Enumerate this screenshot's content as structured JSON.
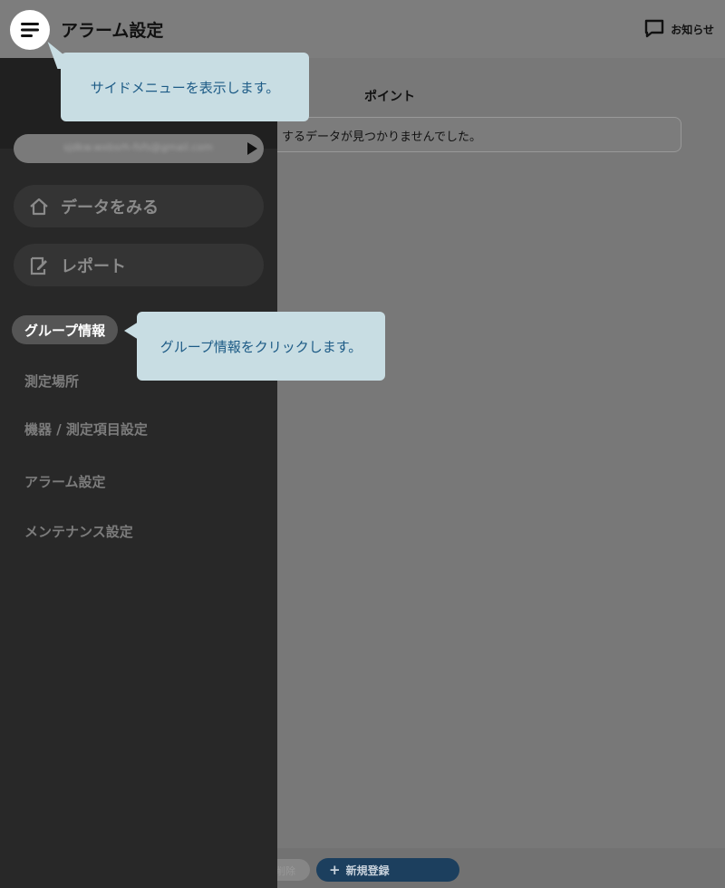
{
  "header": {
    "title": "アラーム設定",
    "notice_label": "お知らせ"
  },
  "main": {
    "column_title": "ポイント",
    "no_data_message": "するデータが見つかりませんでした。"
  },
  "bottom": {
    "delete_label": "削除",
    "new_label": "新規登録"
  },
  "sidebar": {
    "account_email": "sjdkw.wxbsrh-fsfs@gmail.com",
    "nav": [
      {
        "label": "データをみる",
        "icon": "home-icon"
      },
      {
        "label": "レポート",
        "icon": "report-icon"
      }
    ],
    "items": [
      {
        "label": "グループ情報",
        "active": true
      },
      {
        "label": "測定場所"
      },
      {
        "label": "機器 / 測定項目設定"
      },
      {
        "label": "アラーム設定"
      },
      {
        "label": "メンテナンス設定"
      }
    ]
  },
  "tooltips": {
    "menu_tip": "サイドメニューを表示します。",
    "group_tip": "グループ情報をクリックします。"
  },
  "colors": {
    "tooltip_bg": "#c8dde3",
    "tooltip_text": "#1d5b86",
    "sidebar_bg": "#282828",
    "new_button_bg": "#1c3f5e"
  }
}
